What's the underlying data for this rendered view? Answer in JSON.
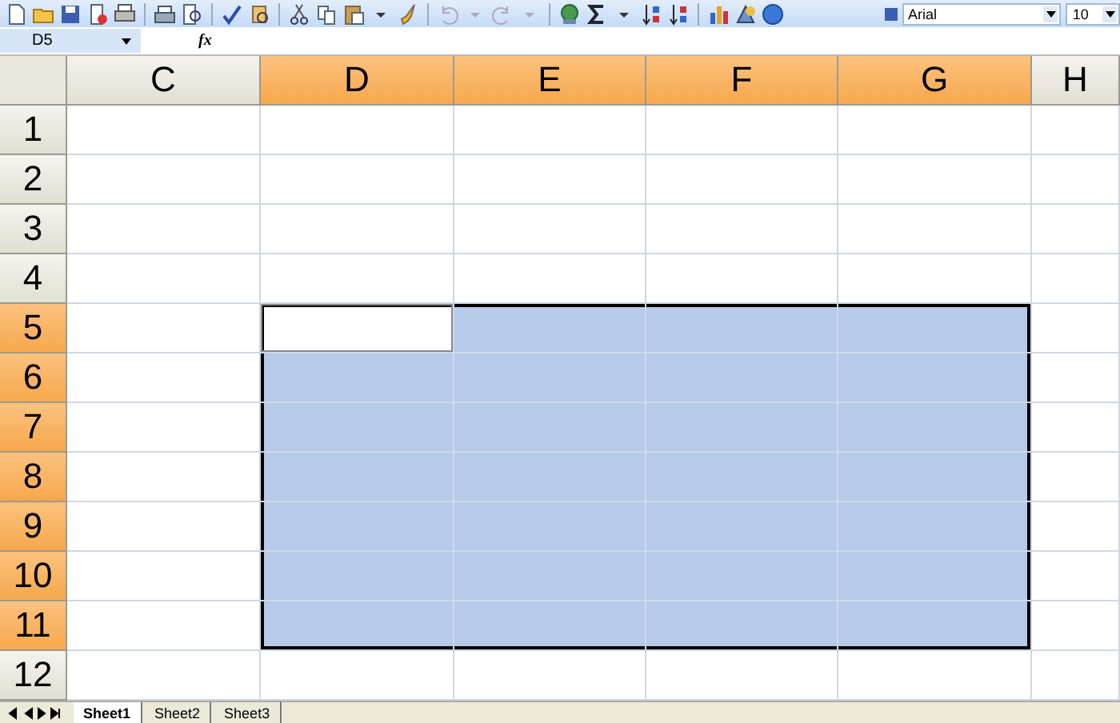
{
  "toolbar": {
    "font": "Arial",
    "font_size": "10"
  },
  "formula_bar": {
    "name_box": "D5",
    "function_label": "fx"
  },
  "columns": [
    {
      "label": "C",
      "selected": false
    },
    {
      "label": "D",
      "selected": true
    },
    {
      "label": "E",
      "selected": true
    },
    {
      "label": "F",
      "selected": true
    },
    {
      "label": "G",
      "selected": true
    },
    {
      "label": "H",
      "selected": false
    }
  ],
  "rows": [
    {
      "label": "1",
      "selected": false,
      "cells": [
        {
          "selected": false,
          "active": false
        },
        {
          "selected": false,
          "active": false
        },
        {
          "selected": false,
          "active": false
        },
        {
          "selected": false,
          "active": false
        },
        {
          "selected": false,
          "active": false
        },
        {
          "selected": false,
          "active": false
        }
      ]
    },
    {
      "label": "2",
      "selected": false,
      "cells": [
        {
          "selected": false,
          "active": false
        },
        {
          "selected": false,
          "active": false
        },
        {
          "selected": false,
          "active": false
        },
        {
          "selected": false,
          "active": false
        },
        {
          "selected": false,
          "active": false
        },
        {
          "selected": false,
          "active": false
        }
      ]
    },
    {
      "label": "3",
      "selected": false,
      "cells": [
        {
          "selected": false,
          "active": false
        },
        {
          "selected": false,
          "active": false
        },
        {
          "selected": false,
          "active": false
        },
        {
          "selected": false,
          "active": false
        },
        {
          "selected": false,
          "active": false
        },
        {
          "selected": false,
          "active": false
        }
      ]
    },
    {
      "label": "4",
      "selected": false,
      "cells": [
        {
          "selected": false,
          "active": false
        },
        {
          "selected": false,
          "active": false
        },
        {
          "selected": false,
          "active": false
        },
        {
          "selected": false,
          "active": false
        },
        {
          "selected": false,
          "active": false
        },
        {
          "selected": false,
          "active": false
        }
      ]
    },
    {
      "label": "5",
      "selected": true,
      "cells": [
        {
          "selected": false,
          "active": false
        },
        {
          "selected": true,
          "active": true
        },
        {
          "selected": true,
          "active": false
        },
        {
          "selected": true,
          "active": false
        },
        {
          "selected": true,
          "active": false
        },
        {
          "selected": false,
          "active": false
        }
      ]
    },
    {
      "label": "6",
      "selected": true,
      "cells": [
        {
          "selected": false,
          "active": false
        },
        {
          "selected": true,
          "active": false
        },
        {
          "selected": true,
          "active": false
        },
        {
          "selected": true,
          "active": false
        },
        {
          "selected": true,
          "active": false
        },
        {
          "selected": false,
          "active": false
        }
      ]
    },
    {
      "label": "7",
      "selected": true,
      "cells": [
        {
          "selected": false,
          "active": false
        },
        {
          "selected": true,
          "active": false
        },
        {
          "selected": true,
          "active": false
        },
        {
          "selected": true,
          "active": false
        },
        {
          "selected": true,
          "active": false
        },
        {
          "selected": false,
          "active": false
        }
      ]
    },
    {
      "label": "8",
      "selected": true,
      "cells": [
        {
          "selected": false,
          "active": false
        },
        {
          "selected": true,
          "active": false
        },
        {
          "selected": true,
          "active": false
        },
        {
          "selected": true,
          "active": false
        },
        {
          "selected": true,
          "active": false
        },
        {
          "selected": false,
          "active": false
        }
      ]
    },
    {
      "label": "9",
      "selected": true,
      "cells": [
        {
          "selected": false,
          "active": false
        },
        {
          "selected": true,
          "active": false
        },
        {
          "selected": true,
          "active": false
        },
        {
          "selected": true,
          "active": false
        },
        {
          "selected": true,
          "active": false
        },
        {
          "selected": false,
          "active": false
        }
      ]
    },
    {
      "label": "10",
      "selected": true,
      "cells": [
        {
          "selected": false,
          "active": false
        },
        {
          "selected": true,
          "active": false
        },
        {
          "selected": true,
          "active": false
        },
        {
          "selected": true,
          "active": false
        },
        {
          "selected": true,
          "active": false
        },
        {
          "selected": false,
          "active": false
        }
      ]
    },
    {
      "label": "11",
      "selected": true,
      "cells": [
        {
          "selected": false,
          "active": false
        },
        {
          "selected": true,
          "active": false
        },
        {
          "selected": true,
          "active": false
        },
        {
          "selected": true,
          "active": false
        },
        {
          "selected": true,
          "active": false
        },
        {
          "selected": false,
          "active": false
        }
      ]
    },
    {
      "label": "12",
      "selected": false,
      "cells": [
        {
          "selected": false,
          "active": false
        },
        {
          "selected": false,
          "active": false
        },
        {
          "selected": false,
          "active": false
        },
        {
          "selected": false,
          "active": false
        },
        {
          "selected": false,
          "active": false
        },
        {
          "selected": false,
          "active": false
        }
      ]
    }
  ],
  "sheet_tabs": [
    {
      "label": "Sheet1",
      "selected": true
    },
    {
      "label": "Sheet2",
      "selected": false
    },
    {
      "label": "Sheet3",
      "selected": false
    }
  ]
}
